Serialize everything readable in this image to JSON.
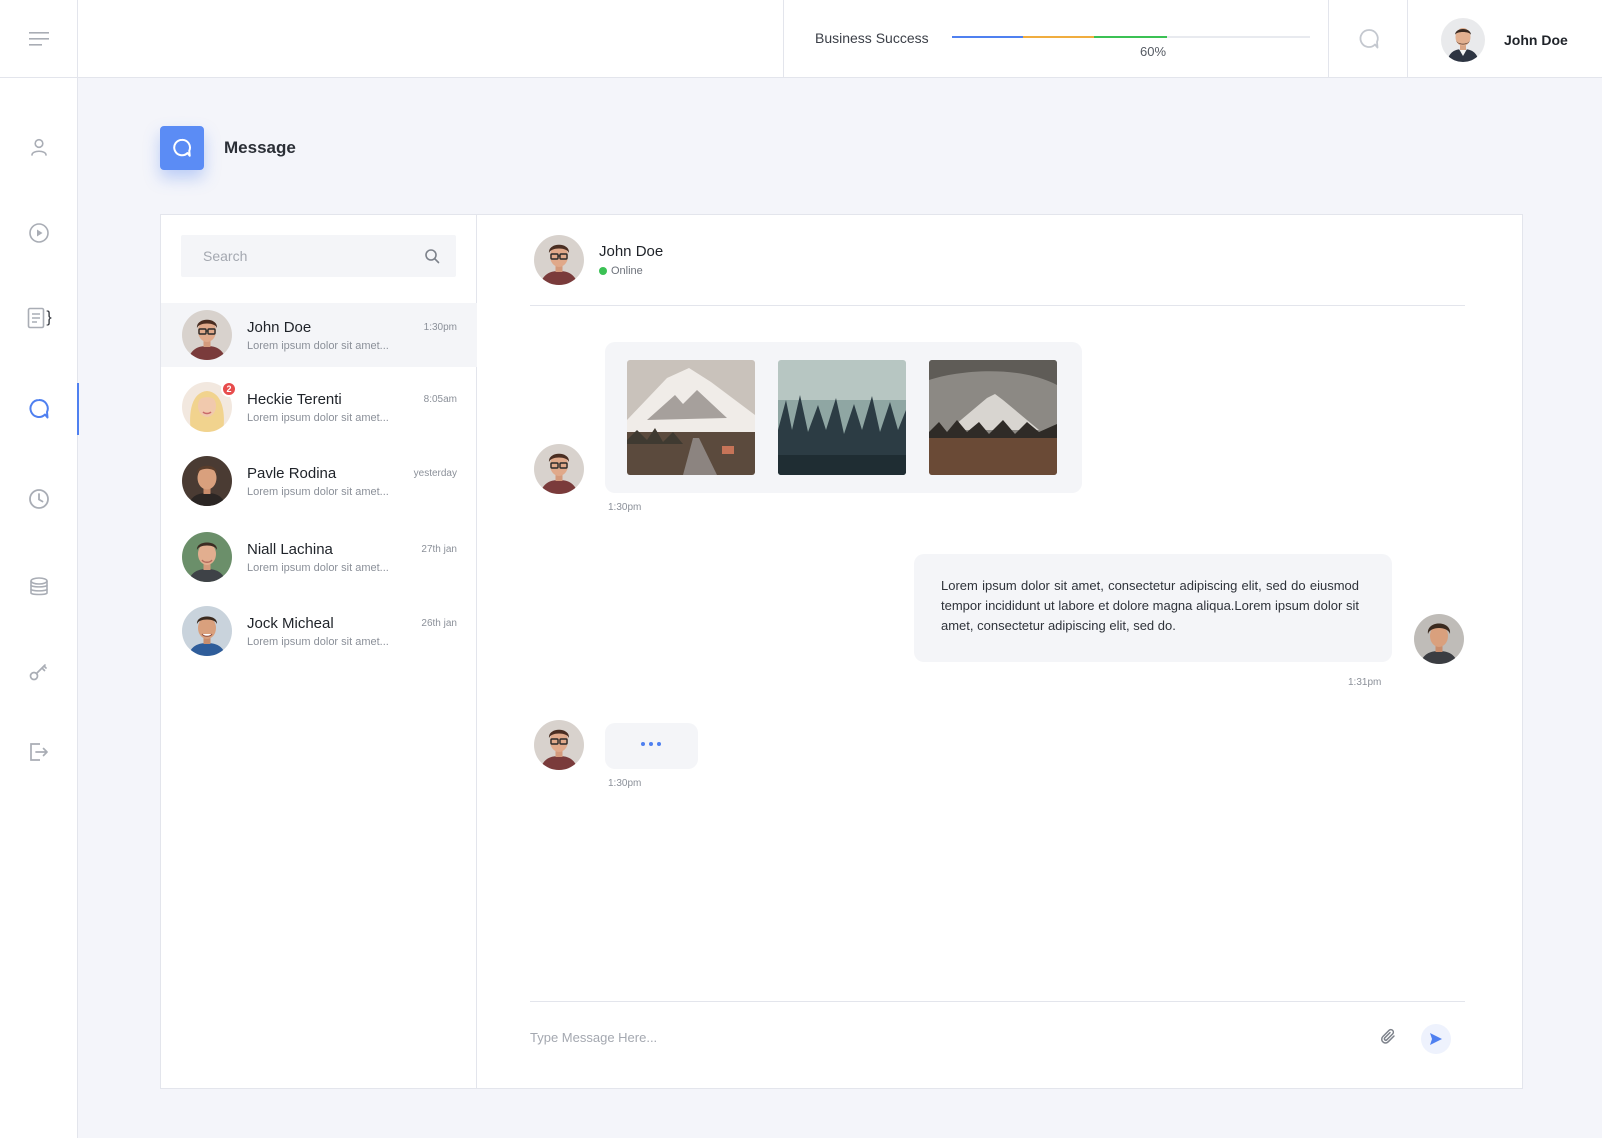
{
  "header": {
    "menu_icon": "hamburger-icon",
    "progress_label": "Business Success",
    "progress_value": "60%",
    "progress_fraction": 0.6,
    "progress_colors": [
      "#4f80f0",
      "#f0ad3f",
      "#3bc154"
    ],
    "chat_icon": "chat-bubble-icon",
    "user_name": "John Doe"
  },
  "sidebar": {
    "items": [
      {
        "icon": "user-icon",
        "active": false
      },
      {
        "icon": "play-circle-icon",
        "active": false
      },
      {
        "icon": "document-icon",
        "active": false
      },
      {
        "icon": "chat-bubble-icon",
        "active": true
      },
      {
        "icon": "clock-icon",
        "active": false
      },
      {
        "icon": "database-icon",
        "active": false
      },
      {
        "icon": "key-icon",
        "active": false
      },
      {
        "icon": "logout-icon",
        "active": false
      }
    ]
  },
  "page": {
    "title": "Message",
    "icon": "chat-bubble-icon",
    "accent": "#5b8cf5"
  },
  "contacts": {
    "search_placeholder": "Search",
    "items": [
      {
        "name": "John Doe",
        "preview": "Lorem ipsum dolor sit amet...",
        "time": "1:30pm",
        "active": true
      },
      {
        "name": "Heckie Terenti",
        "preview": "Lorem ipsum dolor sit amet...",
        "time": "8:05am",
        "badge": "2"
      },
      {
        "name": "Pavle Rodina",
        "preview": "Lorem ipsum dolor sit amet...",
        "time": "yesterday"
      },
      {
        "name": "Niall Lachina",
        "preview": "Lorem ipsum dolor sit amet...",
        "time": "27th jan"
      },
      {
        "name": "Jock Micheal",
        "preview": "Lorem ipsum dolor sit amet...",
        "time": "26th jan"
      }
    ]
  },
  "chat": {
    "name": "John Doe",
    "status": "Online",
    "messages": [
      {
        "type": "images",
        "time": "1:30pm"
      },
      {
        "type": "text",
        "text": "Lorem ipsum dolor sit amet, consectetur adipiscing elit, sed do eiusmod tempor incididunt ut labore et dolore magna aliqua.Lorem ipsum dolor sit amet, consectetur adipiscing elit, sed do.",
        "time": "1:31pm"
      },
      {
        "type": "typing",
        "time": "1:30pm"
      }
    ],
    "composer_placeholder": "Type Message Here...",
    "attach_icon": "paperclip-icon",
    "send_icon": "send-icon"
  }
}
